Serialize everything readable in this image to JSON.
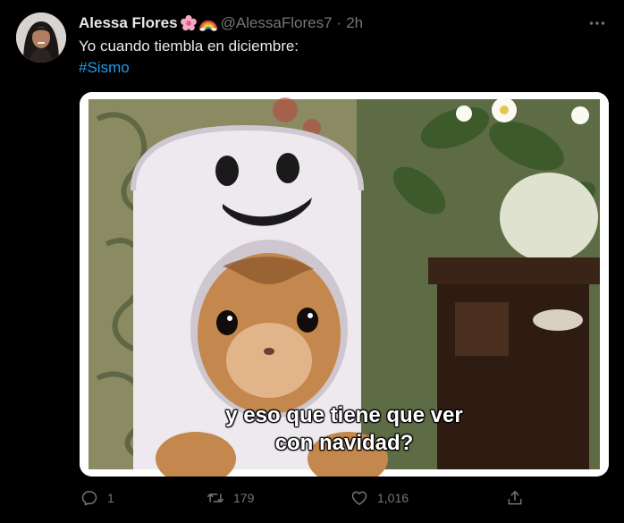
{
  "tweet": {
    "author_name": "Alessa Flores",
    "name_emojis": [
      "cherry-blossom-icon",
      "rainbow-icon"
    ],
    "handle": "@AlessaFlores7",
    "separator": "·",
    "time": "2h",
    "text": "Yo cuando tiembla en diciembre:",
    "hashtag": "#Sismo"
  },
  "media": {
    "caption_line1": "y eso que tiene que ver",
    "caption_line2": "con navidad?"
  },
  "actions": {
    "reply_count": "1",
    "retweet_count": "179",
    "like_count": "1,016"
  },
  "colors": {
    "background": "#000000",
    "text": "#e7e9ea",
    "muted": "#71767b",
    "link": "#1d9bf0"
  }
}
